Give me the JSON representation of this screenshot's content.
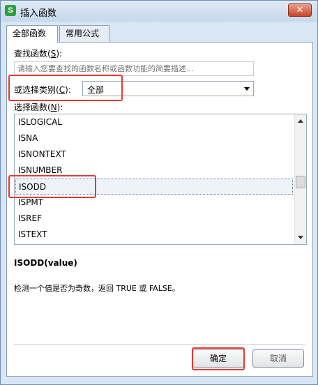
{
  "window": {
    "title": "插入函数",
    "app_icon_letter": "S",
    "close_symbol": "✕"
  },
  "tabs": [
    {
      "label": "全部函数",
      "active": true
    },
    {
      "label": "常用公式",
      "active": false
    }
  ],
  "search": {
    "label_prefix": "查找函数(",
    "label_key": "S",
    "label_suffix": "):",
    "placeholder": "请输入您要查找的函数名称或函数功能的简要描述..."
  },
  "category": {
    "label_prefix": "或选择类别(",
    "label_key": "C",
    "label_suffix": "):",
    "selected": "全部"
  },
  "function_list": {
    "label_prefix": "选择函数(",
    "label_key": "N",
    "label_suffix": "):",
    "items": [
      "ISLOGICAL",
      "ISNA",
      "ISNONTEXT",
      "ISNUMBER",
      "ISODD",
      "ISPMT",
      "ISREF",
      "ISTEXT"
    ],
    "selected": "ISODD"
  },
  "details": {
    "signature": "ISODD(value)",
    "description": "检测一个值是否为奇数，返回 TRUE 或 FALSE。"
  },
  "buttons": {
    "ok": "确定",
    "cancel": "取消"
  },
  "highlight_color": "#e53935"
}
